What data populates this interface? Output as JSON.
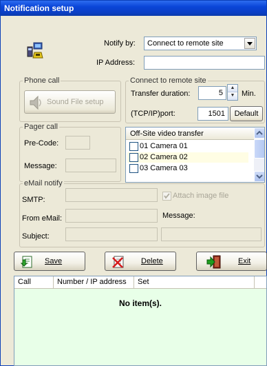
{
  "window": {
    "title": "Notification setup"
  },
  "notify": {
    "notify_by_label": "Notify by:",
    "notify_by_value": "Connect to remote site",
    "ip_label": "IP Address:",
    "ip_value": ""
  },
  "phone_call": {
    "title": "Phone call",
    "sound_button": "Sound File setup"
  },
  "pager_call": {
    "title": "Pager call",
    "precode_label": "Pre-Code:",
    "precode_value": "",
    "message_label": "Message:",
    "message_value": ""
  },
  "remote_site": {
    "title": "Connect to remote site",
    "transfer_label": "Transfer duration:",
    "transfer_value": "5",
    "transfer_unit": "Min.",
    "port_label": "(TCP/IP)port:",
    "port_value": "1501",
    "default_button": "Default"
  },
  "offsite": {
    "header": "Off-Site video transfer",
    "cameras": [
      {
        "label": "01 Camera 01",
        "checked": false,
        "highlight": false
      },
      {
        "label": "02 Camera 02",
        "checked": false,
        "highlight": true
      },
      {
        "label": "03 Camera 03",
        "checked": false,
        "highlight": false
      }
    ]
  },
  "email": {
    "title": "eMail notify",
    "smtp_label": "SMTP:",
    "smtp_value": "",
    "from_label": "From eMail:",
    "from_value": "",
    "subject_label": "Subject:",
    "subject_value": "",
    "attach_label": "Attach image file",
    "attach_checked": true,
    "message_label": "Message:",
    "message_value": ""
  },
  "toolbar": {
    "save_label": "Save",
    "delete_label": "Delete",
    "exit_label": "Exit"
  },
  "table": {
    "columns": [
      "Call",
      "Number / IP address",
      "Set"
    ],
    "empty_text": "No item(s)."
  }
}
